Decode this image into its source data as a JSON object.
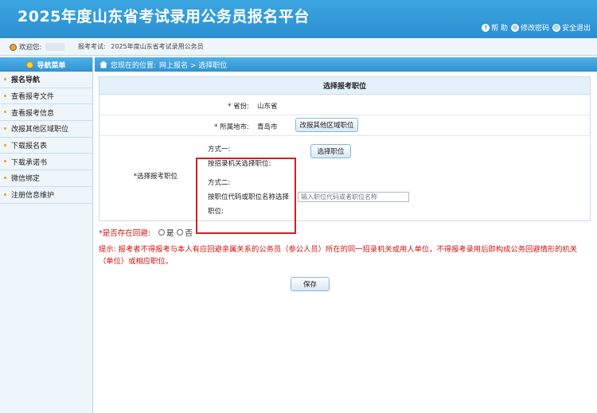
{
  "header": {
    "title": "2025年度山东省考试录用公务员报名平台",
    "help": "帮 助",
    "change_password": "修改密码",
    "logout": "安全退出"
  },
  "userbar": {
    "welcome": "欢迎您:",
    "exam_label": "报考考试:",
    "exam_name": "2025年度山东省考试录用公务员"
  },
  "sidebar": {
    "head": "导航菜单",
    "items": [
      {
        "label": "报名导航"
      },
      {
        "label": "查看报考文件"
      },
      {
        "label": "查看报考信息"
      },
      {
        "label": "改报其他区域职位"
      },
      {
        "label": "下载报名表"
      },
      {
        "label": "下载承诺书"
      },
      {
        "label": "微信绑定"
      },
      {
        "label": "注册信息维护"
      }
    ]
  },
  "breadcrumb": {
    "prefix": "您现在的位置:",
    "path": "网上报名 > 选择职位"
  },
  "form": {
    "title": "选择报考职位",
    "province_label": "* 省份:",
    "province_value": "山东省",
    "city_label": "* 所属地市:",
    "city_value": "青岛市",
    "change_region_button": "改报其他区域职位",
    "position_label": "*选择报考职位",
    "method1_title": "方式一:",
    "method1_desc": "按招录机关选择职位:",
    "select_position_button": "选择职位",
    "method2_title": "方式二:",
    "method2_desc_line1": "按职位代码或职位名称选择",
    "method2_desc_line2": "职位:",
    "position_input_placeholder": "输入职位代码或者职位名称"
  },
  "recusal": {
    "question": "*是否存在回避:",
    "yes": "是",
    "no": "否"
  },
  "tip": "提示: 报考者不得报考与本人有应回避亲属关系的公务员（参公人员）所在的同一招录机关或用人单位，不得报考录用后即构成公务回避情形的机关（单位）或相应职位。",
  "save_button": "保存"
}
